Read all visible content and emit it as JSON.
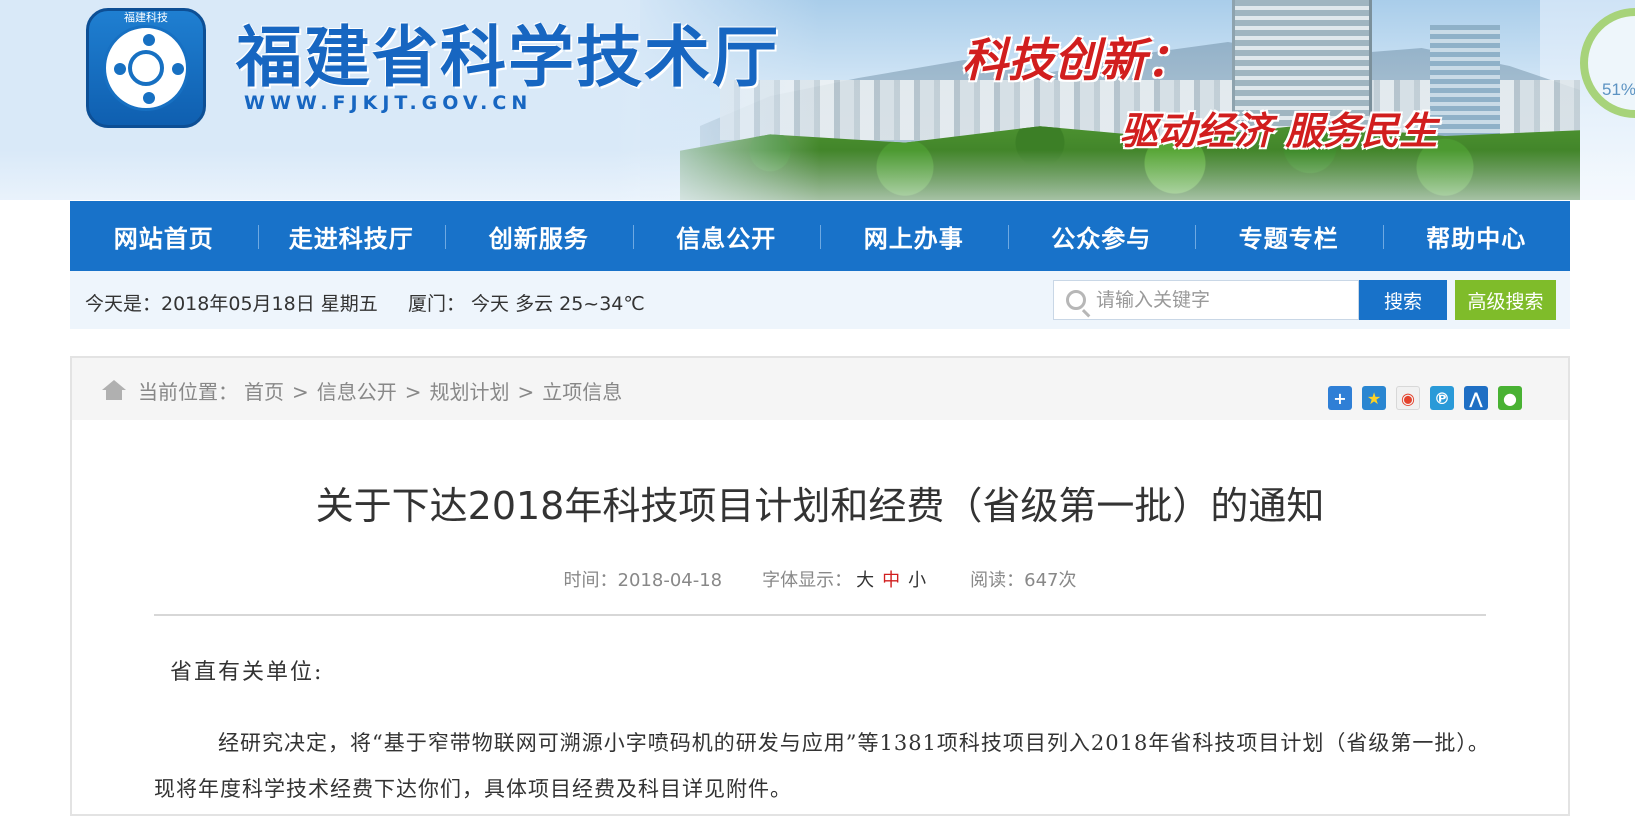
{
  "header": {
    "site_title": "福建省科学技术厅",
    "site_url": "WWW.FJKJT.GOV.CN",
    "emblem_text": "福建科技",
    "slogan_line1": "科技创新：",
    "slogan_line2": "驱动经济 服务民生",
    "progress_text": "51%"
  },
  "nav": {
    "items": [
      {
        "label": "网站首页"
      },
      {
        "label": "走进科技厅"
      },
      {
        "label": "创新服务"
      },
      {
        "label": "信息公开"
      },
      {
        "label": "网上办事"
      },
      {
        "label": "公众参与"
      },
      {
        "label": "专题专栏"
      },
      {
        "label": "帮助中心"
      }
    ]
  },
  "infobar": {
    "date_text": "今天是：2018年05月18日  星期五",
    "weather_text": "厦门：  今天 多云 25~34℃",
    "search_placeholder": "请输入关键字",
    "search_label": "搜索",
    "advanced_search_label": "高级搜索"
  },
  "breadcrumb": {
    "label": "当前位置：",
    "items": [
      "首页",
      "信息公开",
      "规划计划",
      "立项信息"
    ],
    "separator": ">"
  },
  "share_icons": [
    "plus-icon",
    "qzone-icon",
    "weibo-icon",
    "tencent-weibo-icon",
    "renren-icon",
    "wechat-icon"
  ],
  "article": {
    "title": "关于下达2018年科技项目计划和经费（省级第一批）的通知",
    "time_label": "时间：2018-04-18",
    "font_label": "字体显示：",
    "font_large": "大",
    "font_medium": "中",
    "font_small": "小",
    "reads_label": "阅读：647次",
    "salutation": "省直有关单位:",
    "body": "经研究决定，将“基于窄带物联网可溯源小字喷码机的研发与应用”等1381项科技项目列入2018年省科技项目计划（省级第一批）。现将年度科学技术经费下达你们，具体项目经费及科目详见附件。"
  },
  "colors": {
    "brand_blue": "#1872c9",
    "advanced_green": "#7fbc2a",
    "slogan_red": "#d11e1e"
  }
}
